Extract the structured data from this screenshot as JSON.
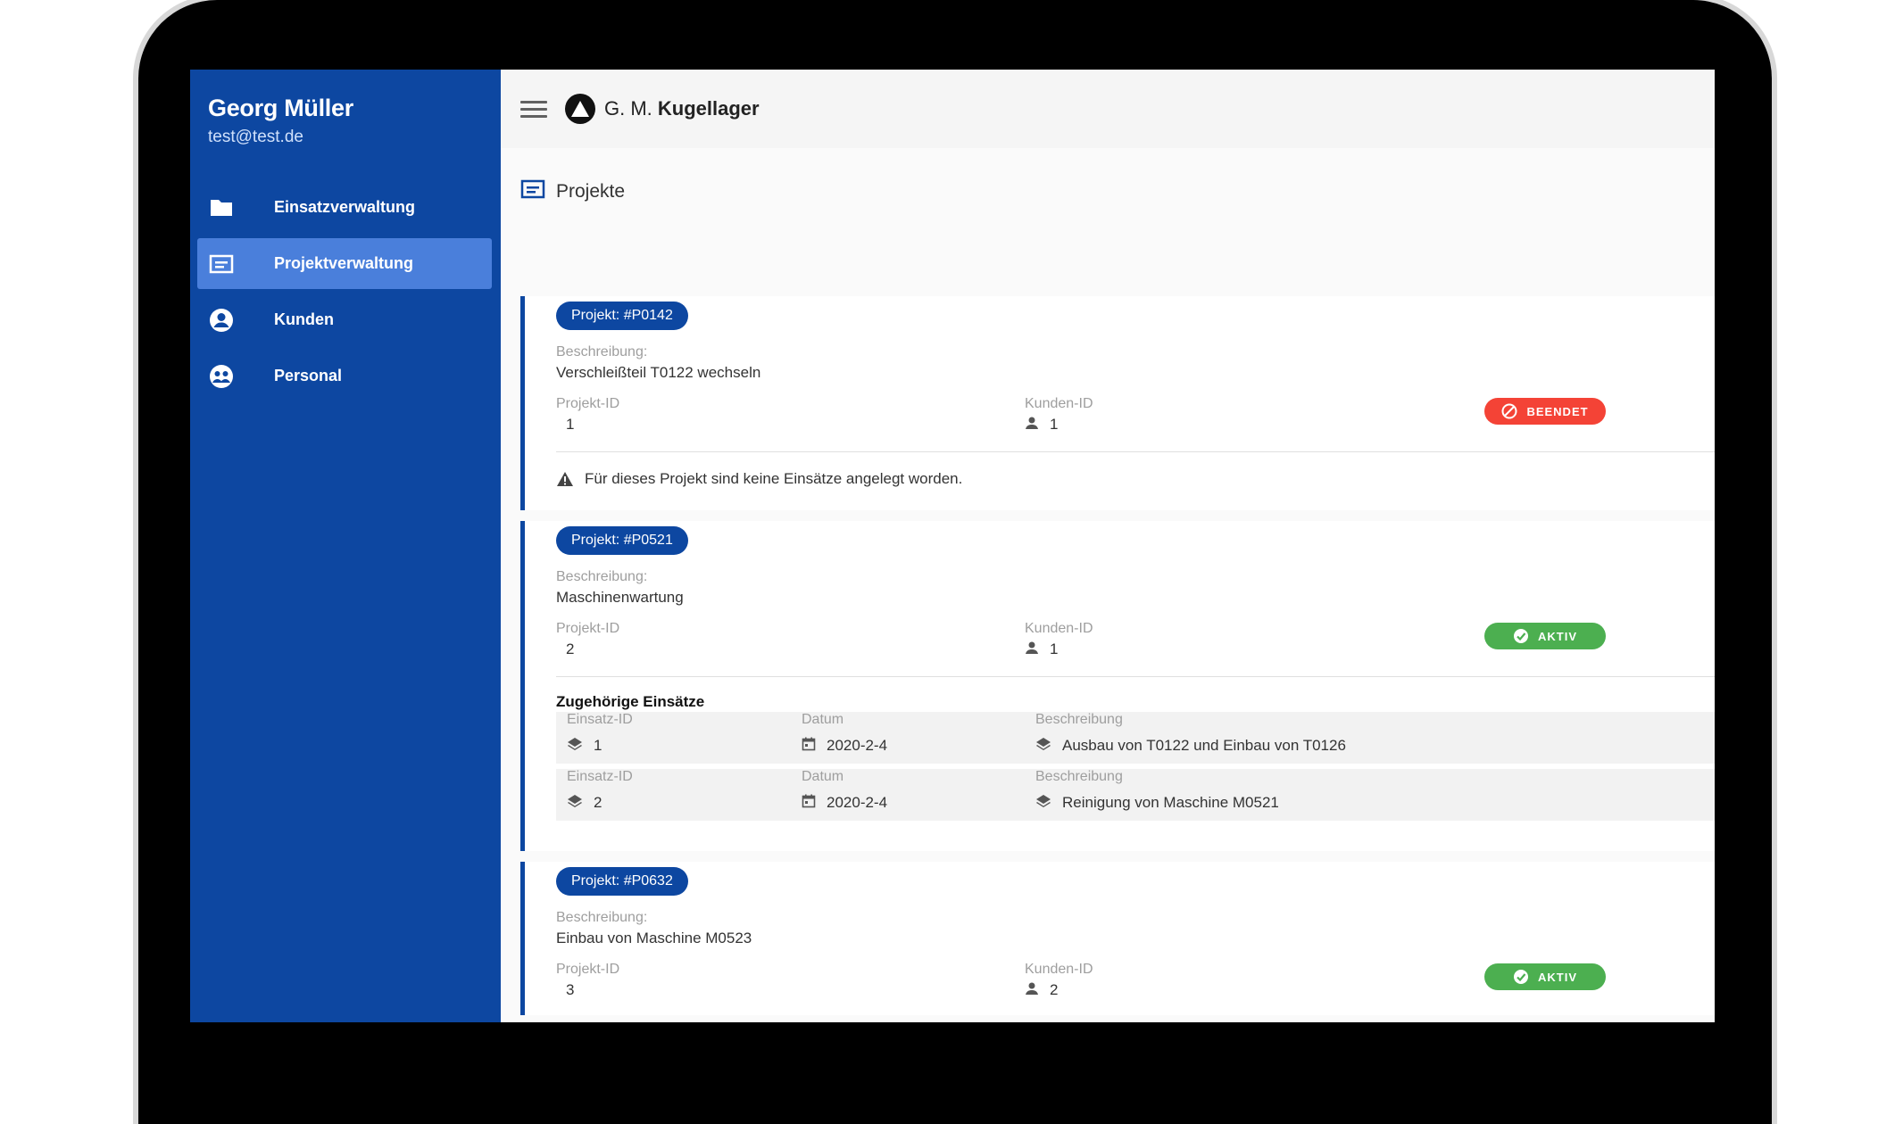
{
  "sidebar": {
    "user_name": "Georg Müller",
    "user_email": "test@test.de",
    "items": [
      {
        "label": "Einsatzverwaltung",
        "icon": "folder-icon"
      },
      {
        "label": "Projektverwaltung",
        "icon": "project-list-icon",
        "active": true
      },
      {
        "label": "Kunden",
        "icon": "account-circle-icon"
      },
      {
        "label": "Personal",
        "icon": "people-icon"
      }
    ]
  },
  "topbar": {
    "brand_prefix": "G. M.",
    "brand_name": "Kugellager"
  },
  "main": {
    "title": "Projekte"
  },
  "projects": [
    {
      "badge": "Projekt: #P0142",
      "desc_label": "Beschreibung:",
      "description": "Verschleißteil T0122 wechseln",
      "project_id_label": "Projekt-ID",
      "project_id": "1",
      "customer_id_label": "Kunden-ID",
      "customer_id": "1",
      "status": "BEENDET",
      "warning": "Für dieses Projekt sind keine Einsätze angelegt worden."
    },
    {
      "badge": "Projekt: #P0521",
      "desc_label": "Beschreibung:",
      "description": "Maschinenwartung",
      "project_id_label": "Projekt-ID",
      "project_id": "2",
      "customer_id_label": "Kunden-ID",
      "customer_id": "1",
      "status": "AKTIV",
      "einsaetze_title": "Zugehörige Einsätze",
      "einsaetze": [
        {
          "id_label": "Einsatz-ID",
          "id": "1",
          "date_label": "Datum",
          "date": "2020-2-4",
          "desc_label": "Beschreibung",
          "desc": "Ausbau von T0122 und Einbau von T0126"
        },
        {
          "id_label": "Einsatz-ID",
          "id": "2",
          "date_label": "Datum",
          "date": "2020-2-4",
          "desc_label": "Beschreibung",
          "desc": "Reinigung von Maschine M0521"
        }
      ]
    },
    {
      "badge": "Projekt: #P0632",
      "desc_label": "Beschreibung:",
      "description": "Einbau von Maschine M0523",
      "project_id_label": "Projekt-ID",
      "project_id": "3",
      "customer_id_label": "Kunden-ID",
      "customer_id": "2",
      "status": "AKTIV"
    }
  ],
  "colors": {
    "primary": "#0d47a1",
    "sidebar_active": "#4a7fdb",
    "status_done": "#f44336",
    "status_active": "#4caf50"
  }
}
